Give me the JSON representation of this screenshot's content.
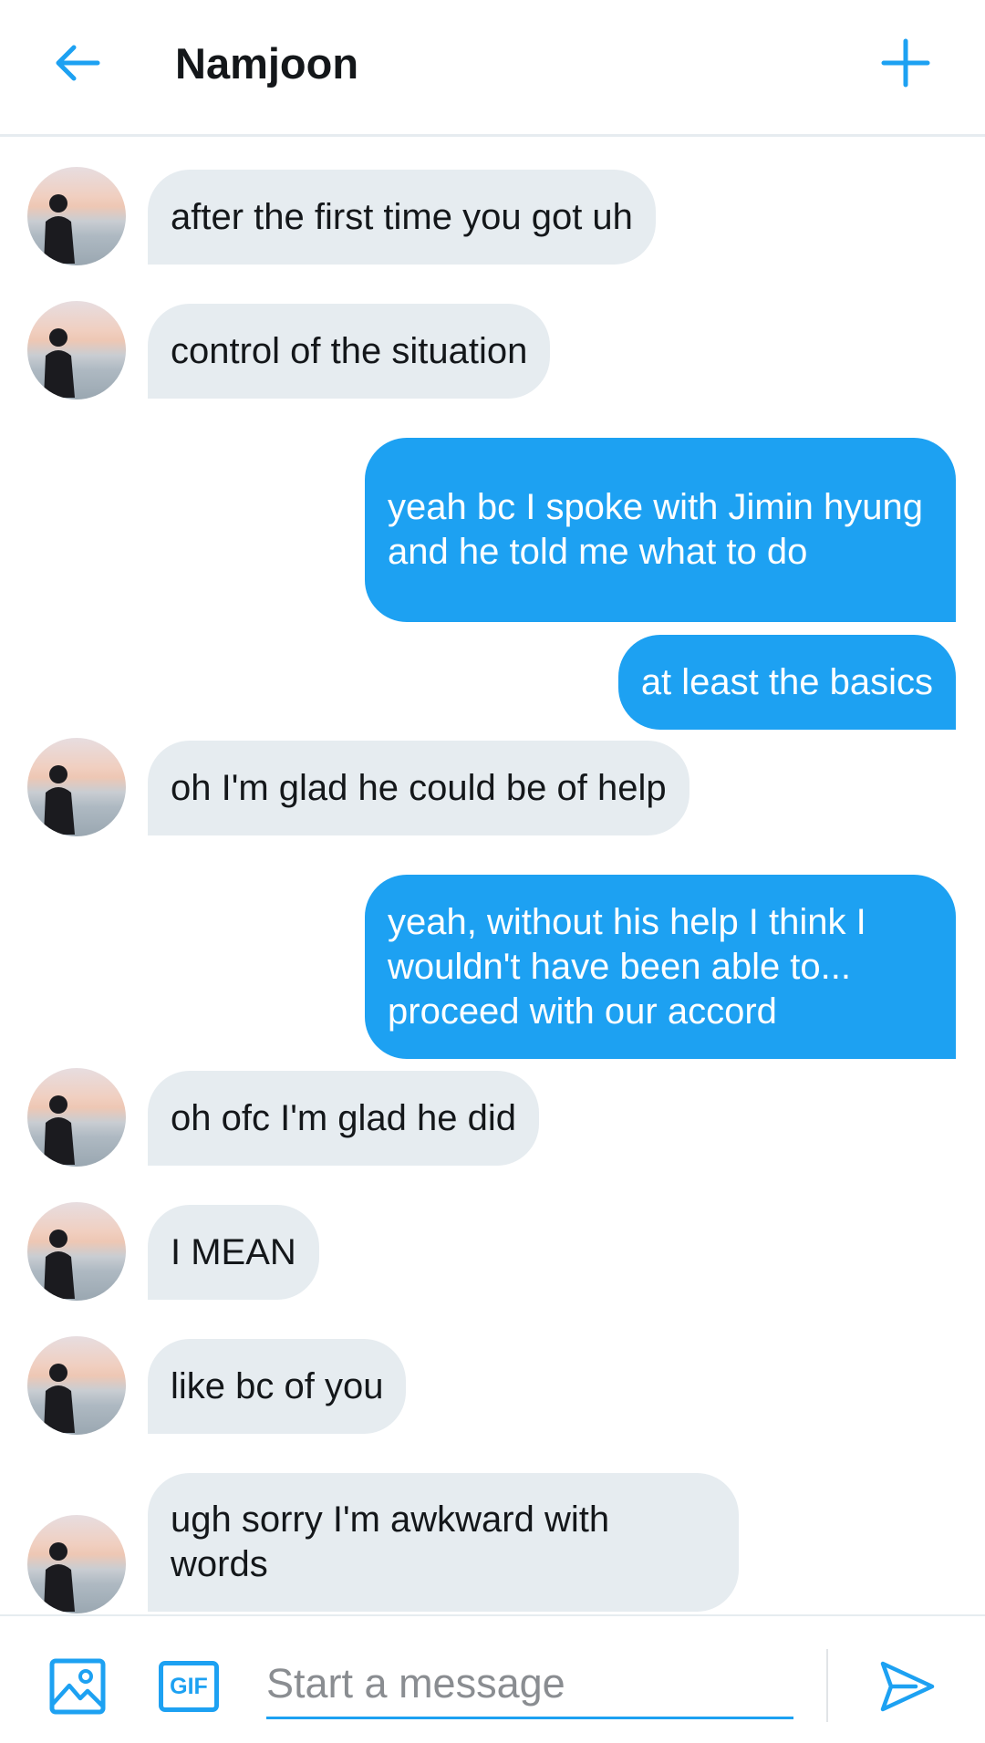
{
  "header": {
    "title": "Namjoon",
    "back_icon": "arrow-left-icon",
    "new_icon": "plus-icon"
  },
  "messages": [
    {
      "from": "them",
      "text": "after the first time you got uh"
    },
    {
      "from": "them",
      "text": "control of the situation"
    },
    {
      "from": "me",
      "text": "yeah bc I spoke with Jimin hyung and he told me what to do"
    },
    {
      "from": "me",
      "text": "at least the basics"
    },
    {
      "from": "them",
      "text": "oh I'm glad he could be of help"
    },
    {
      "from": "me",
      "text": "yeah, without his help I think I wouldn't have been able to... proceed with our accord"
    },
    {
      "from": "them",
      "text": "oh ofc I'm glad he did"
    },
    {
      "from": "them",
      "text": "I MEAN"
    },
    {
      "from": "them",
      "text": "like bc of you"
    },
    {
      "from": "them",
      "text": "ugh sorry I'm awkward with words"
    }
  ],
  "composer": {
    "placeholder": "Start a message",
    "gif_label": "GIF",
    "media_icon": "image-icon",
    "send_icon": "send-icon"
  },
  "colors": {
    "accent": "#1da1f2",
    "incoming_bubble": "#e6ecf0",
    "text": "#14171a"
  }
}
